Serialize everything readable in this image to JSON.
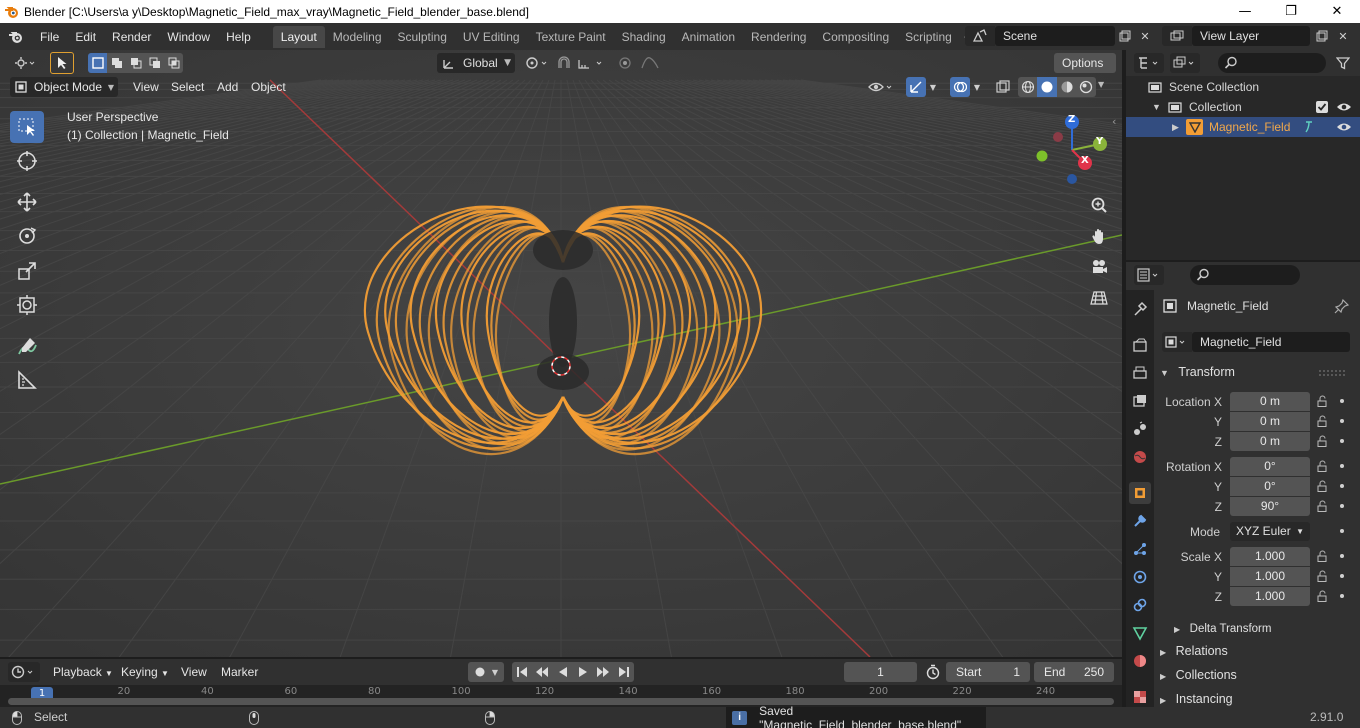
{
  "window": {
    "title": "Blender [C:\\Users\\a y\\Desktop\\Magnetic_Field_max_vray\\Magnetic_Field_blender_base.blend]",
    "minimize": "—",
    "maximize": "❐",
    "close": "✕"
  },
  "menubar": {
    "items": [
      "File",
      "Edit",
      "Render",
      "Window",
      "Help"
    ],
    "workspaces": [
      "Layout",
      "Modeling",
      "Sculpting",
      "UV Editing",
      "Texture Paint",
      "Shading",
      "Animation",
      "Rendering",
      "Compositing",
      "Scripting"
    ],
    "add_tab": "+",
    "scene": "Scene",
    "view_layer": "View Layer"
  },
  "viewport": {
    "mode": "Object Mode",
    "menus": [
      "View",
      "Select",
      "Add",
      "Object"
    ],
    "transform_orientation": "Global",
    "options": "Options",
    "overlay_title": "User Perspective",
    "overlay_subtitle": "(1) Collection | Magnetic_Field",
    "gizmo": {
      "x": "X",
      "y": "Y",
      "z": "Z"
    },
    "colors": {
      "background": "#3d3d3d",
      "selection": "#f29d35",
      "x_axis": "#b03a3a",
      "y_axis": "#6a9a2a"
    }
  },
  "timeline": {
    "menus": [
      "Playback",
      "Keying",
      "View",
      "Marker"
    ],
    "current_frame": "1",
    "start_label": "Start",
    "start": "1",
    "end_label": "End",
    "end": "250",
    "ruler": [
      "1",
      "20",
      "40",
      "60",
      "80",
      "100",
      "120",
      "140",
      "160",
      "180",
      "200",
      "220",
      "240"
    ]
  },
  "statusbar": {
    "select": "Select",
    "message": "Saved \"Magnetic_Field_blender_base.blend\"",
    "version": "2.91.0"
  },
  "outliner": {
    "scene_collection": "Scene Collection",
    "collection": "Collection",
    "object": "Magnetic_Field"
  },
  "properties": {
    "object_name": "Magnetic_Field",
    "data_name": "Magnetic_Field",
    "transform_header": "Transform",
    "location_label": "Location X",
    "rotation_label": "Rotation X",
    "scale_label": "Scale X",
    "y_label": "Y",
    "z_label": "Z",
    "location": [
      "0 m",
      "0 m",
      "0 m"
    ],
    "rotation": [
      "0°",
      "0°",
      "90°"
    ],
    "mode_label": "Mode",
    "mode": "XYZ Euler",
    "scale": [
      "1.000",
      "1.000",
      "1.000"
    ],
    "delta_transform": "Delta Transform",
    "relations": "Relations",
    "collections": "Collections",
    "instancing": "Instancing"
  }
}
